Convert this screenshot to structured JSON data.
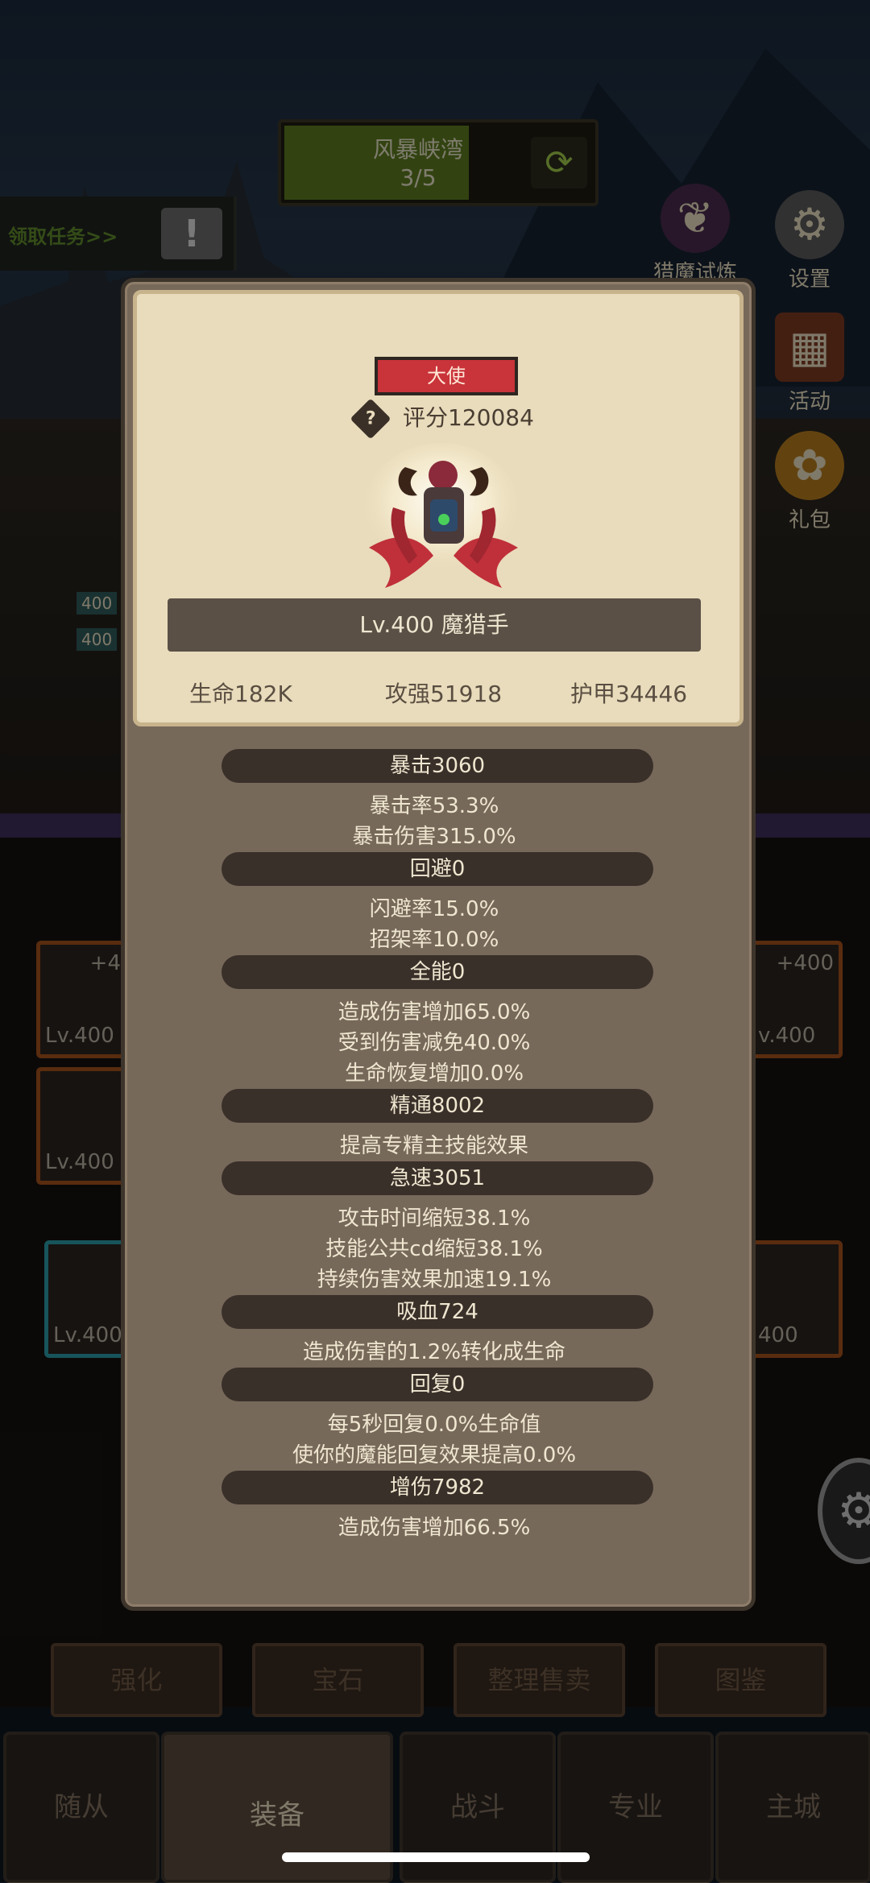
{
  "hud": {
    "stage_name": "风暴峡湾",
    "stage_progress": "3/5",
    "stage_progress_fraction": 0.6,
    "task_label": "领取任务>>",
    "task_icon": "!"
  },
  "side_menu": [
    {
      "label": "猎魔试炼",
      "icon": "bat-wing-icon"
    },
    {
      "label": "设置",
      "icon": "gear-icon"
    },
    {
      "label": "活动",
      "icon": "calendar-icon"
    },
    {
      "label": "礼包",
      "icon": "gift-bag-icon"
    }
  ],
  "equipment_slots": [
    {
      "level": "Lv.400",
      "plus": "+4"
    },
    {
      "level": "Lv.400",
      "plus": ""
    },
    {
      "level": "Lv.400",
      "plus": ""
    },
    {
      "level": "v.400",
      "plus": "+400"
    },
    {
      "level": "400",
      "plus": ""
    }
  ],
  "side_level_badges": [
    "400",
    "400"
  ],
  "tools": [
    "强化",
    "宝石",
    "整理售卖",
    "图鉴"
  ],
  "nav": [
    "随从",
    "装备",
    "战斗",
    "专业",
    "主城"
  ],
  "nav_active": "装备",
  "modal": {
    "rank": "大使",
    "help_icon": "?",
    "score": "评分120084",
    "name": "Lv.400 魔猎手",
    "summary": {
      "hp": "生命182K",
      "attack": "攻强51918",
      "armor": "护甲34446"
    },
    "stats": {
      "crit_header": "暴击3060",
      "crit_rate": "暴击率53.3%",
      "crit_damage": "暴击伤害315.0%",
      "avoid_header": "回避0",
      "dodge_rate": "闪避率15.0%",
      "parry_rate": "招架率10.0%",
      "versatility_header": "全能0",
      "damage_inc": "造成伤害增加65.0%",
      "damage_red": "受到伤害减免40.0%",
      "heal_inc": "生命恢复增加0.0%",
      "mastery_header": "精通8002",
      "mastery_desc": "提高专精主技能效果",
      "haste_header": "急速3051",
      "attack_time": "攻击时间缩短38.1%",
      "gcd": "技能公共cd缩短38.1%",
      "dot_speed": "持续伤害效果加速19.1%",
      "leech_header": "吸血724",
      "leech_desc": "造成伤害的1.2%转化成生命",
      "regen_header": "回复0",
      "regen_hp": "每5秒回复0.0%生命值",
      "regen_mana": "使你的魔能回复效果提高0.0%",
      "dmg_boost_header": "增伤7982",
      "dmg_boost_desc": "造成伤害增加66.5%"
    }
  }
}
